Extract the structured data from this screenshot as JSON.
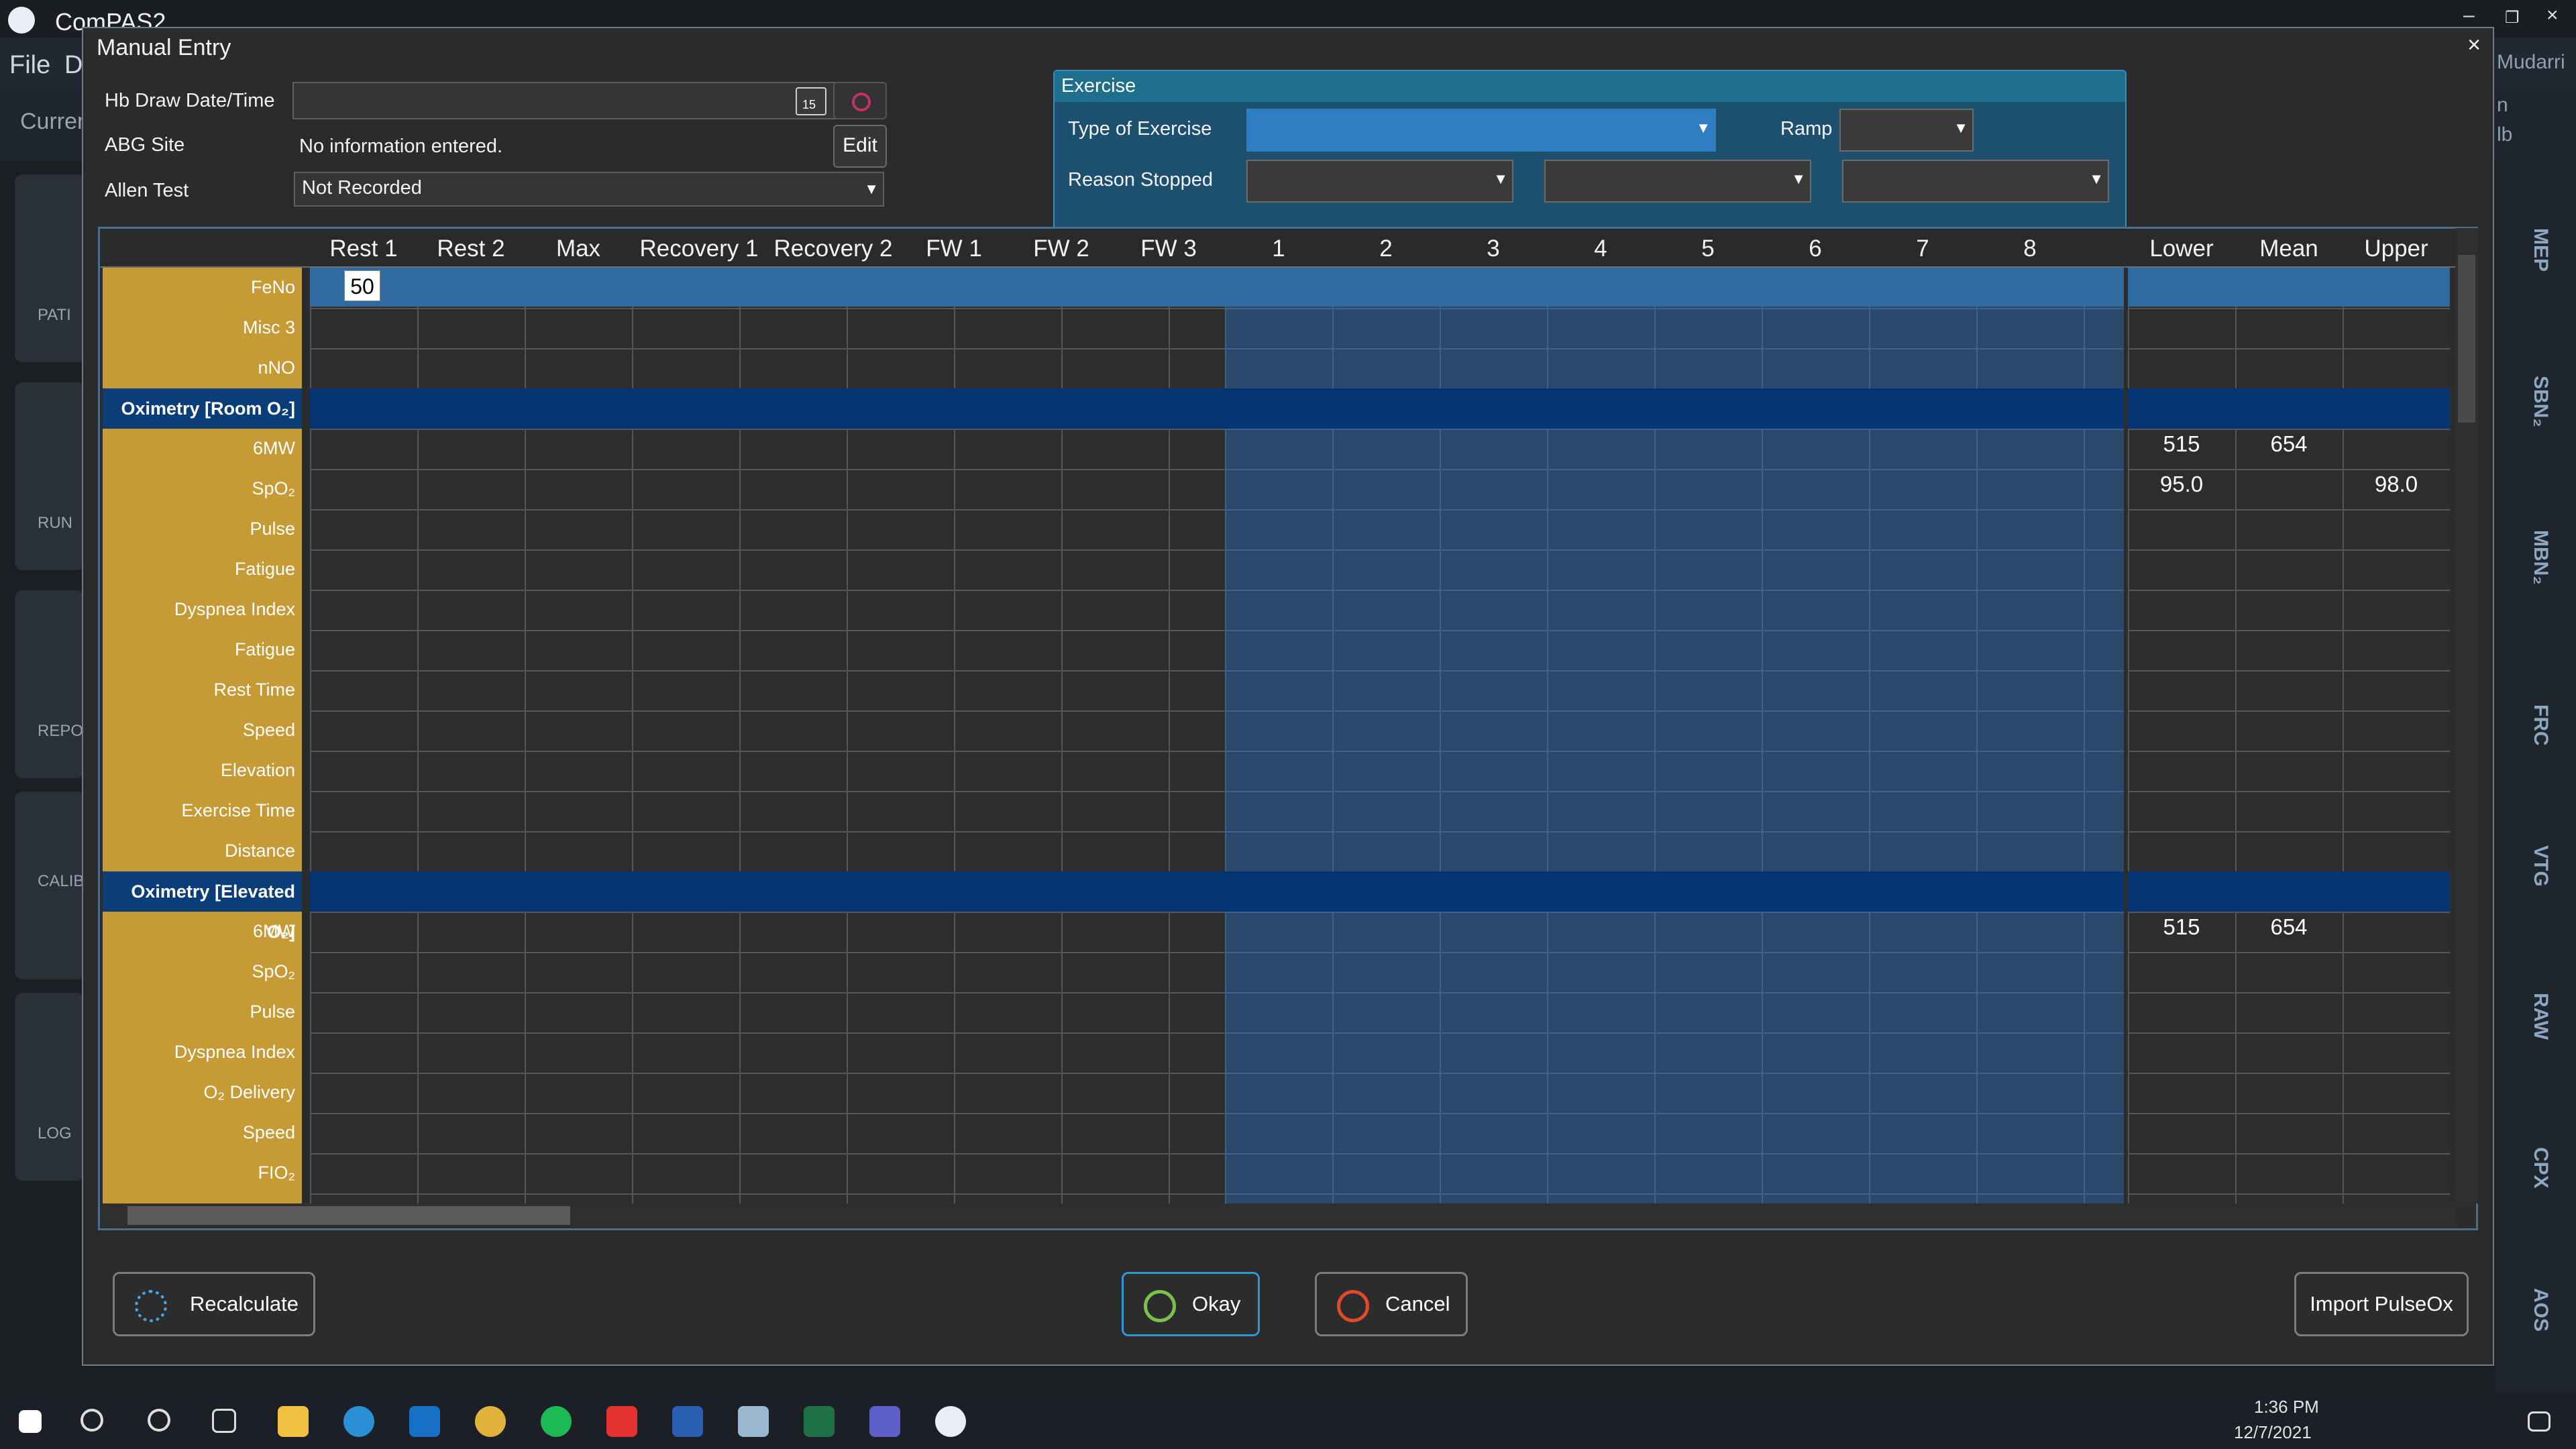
{
  "app": {
    "title": "ComPAS2",
    "menu": [
      "File",
      "D"
    ],
    "sub_label": "Curren",
    "left_nav": [
      "PATI",
      "RUN",
      "REPO",
      "CALIB",
      "LOG"
    ],
    "right_user": "Mudarri",
    "right_misc": [
      "n",
      "lb"
    ],
    "right_tabs": [
      "MEP",
      "SBN₂",
      "MBN₂",
      "FRC",
      "VTG",
      "RAW",
      "CPX",
      "AOS"
    ]
  },
  "dialog": {
    "title": "Manual Entry",
    "close": "×",
    "hb_label": "Hb Draw Date/Time",
    "hb_value": "",
    "abg_label": "ABG Site",
    "abg_value": "No information entered.",
    "edit_label": "Edit",
    "allen_label": "Allen Test",
    "allen_value": "Not Recorded",
    "exercise": {
      "title": "Exercise",
      "type_label": "Type of Exercise",
      "type_value": "",
      "ramp_label": "Ramp",
      "ramp_value": "",
      "reason_label": "Reason Stopped",
      "reason_values": [
        "",
        "",
        ""
      ]
    },
    "grid": {
      "columns": [
        "Rest 1",
        "Rest 2",
        "Max",
        "Recovery 1",
        "Recovery 2",
        "FW 1",
        "FW 2",
        "FW 3",
        "1",
        "2",
        "3",
        "4",
        "5",
        "6",
        "7",
        "8"
      ],
      "ref_columns": [
        "Lower",
        "Mean",
        "Upper"
      ],
      "rows_top": [
        "FeNo",
        "Misc 3",
        "nNO"
      ],
      "band1": "Oximetry [Room O₂]",
      "rows_room": [
        "6MW",
        "SpO₂",
        "Pulse",
        "Fatigue",
        "Dyspnea Index",
        "Fatigue",
        "Rest Time",
        "Speed",
        "Elevation",
        "Exercise Time",
        "Distance"
      ],
      "band2": "Oximetry [Elevated O₂]",
      "rows_elev": [
        "6MW",
        "SpO₂",
        "Pulse",
        "Dyspnea Index",
        "O₂ Delivery",
        "Speed",
        "FIO₂"
      ],
      "active_input": "50",
      "ref_values": {
        "room_6mw_lower": "515",
        "room_6mw_mean": "654",
        "room_spo2_lower": "95.0",
        "room_spo2_upper": "98.0",
        "elev_6mw_lower": "515",
        "elev_6mw_mean": "654"
      }
    },
    "buttons": {
      "recalculate": "Recalculate",
      "okay": "Okay",
      "cancel": "Cancel",
      "import": "Import PulseOx"
    }
  },
  "taskbar": {
    "time": "1:36 PM",
    "date": "12/7/2021"
  },
  "colors": {
    "label_col": "#c69a34",
    "band": "#053573",
    "accent": "#1d6f8c"
  }
}
